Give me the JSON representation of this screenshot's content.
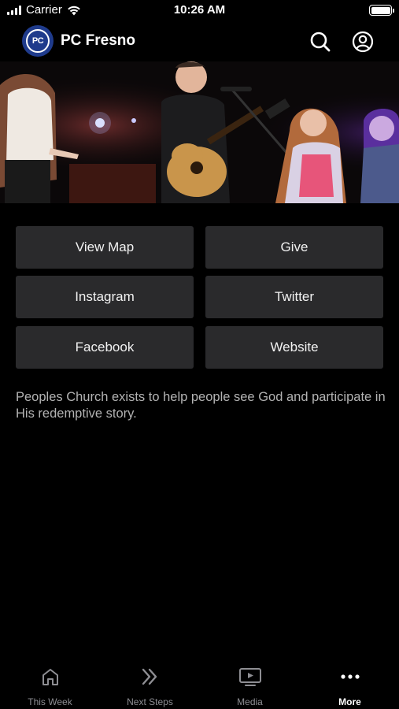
{
  "status_bar": {
    "carrier": "Carrier",
    "time": "10:26 AM"
  },
  "header": {
    "title": "PC Fresno",
    "logo_text": "PC"
  },
  "buttons": {
    "view_map": "View Map",
    "give": "Give",
    "instagram": "Instagram",
    "twitter": "Twitter",
    "facebook": "Facebook",
    "website": "Website"
  },
  "about_text": "Peoples Church exists to help people see God and participate in His redemptive story.",
  "tabs": [
    {
      "label": "This Week",
      "icon": "home-icon"
    },
    {
      "label": "Next Steps",
      "icon": "double-chevron-icon"
    },
    {
      "label": "Media",
      "icon": "tv-play-icon"
    },
    {
      "label": "More",
      "icon": "more-dots-icon",
      "active": true
    }
  ],
  "colors": {
    "background": "#000000",
    "button_bg": "#2a2a2c",
    "logo_bg": "#1f3b8c",
    "tab_inactive": "#8e8e93"
  }
}
